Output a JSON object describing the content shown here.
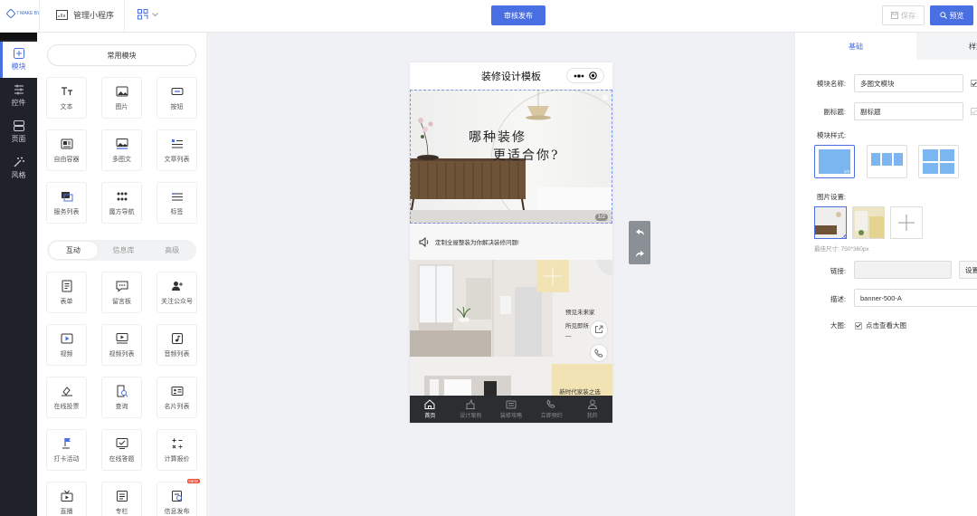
{
  "header": {
    "logo_text": "7 MAKE BY",
    "app_title": "管理小程序",
    "publish_label": "审核发布",
    "save_label": "保存",
    "preview_label": "预览"
  },
  "nav": {
    "items": [
      {
        "label": "模块"
      },
      {
        "label": "控件"
      },
      {
        "label": "页面"
      },
      {
        "label": "风格"
      }
    ]
  },
  "palette": {
    "common_label": "常用模块",
    "common": [
      {
        "label": "文本",
        "icon": "text-icon"
      },
      {
        "label": "图片",
        "icon": "image-icon"
      },
      {
        "label": "按钮",
        "icon": "button-icon"
      },
      {
        "label": "自由容器",
        "icon": "container-icon"
      },
      {
        "label": "多图文",
        "icon": "multi-image-text-icon"
      },
      {
        "label": "文章列表",
        "icon": "article-list-icon"
      },
      {
        "label": "服务列表",
        "icon": "service-list-icon"
      },
      {
        "label": "魔方导航",
        "icon": "cube-nav-icon"
      },
      {
        "label": "标签",
        "icon": "tag-icon"
      }
    ],
    "tabs": [
      "互动",
      "信息库",
      "高级"
    ],
    "interactive": [
      {
        "label": "表单",
        "icon": "form-icon"
      },
      {
        "label": "留言板",
        "icon": "message-board-icon"
      },
      {
        "label": "关注公众号",
        "icon": "follow-account-icon"
      },
      {
        "label": "视频",
        "icon": "video-icon"
      },
      {
        "label": "视频列表",
        "icon": "video-list-icon"
      },
      {
        "label": "音频列表",
        "icon": "audio-list-icon"
      },
      {
        "label": "在线投票",
        "icon": "online-vote-icon"
      },
      {
        "label": "查询",
        "icon": "query-icon"
      },
      {
        "label": "名片列表",
        "icon": "business-card-icon"
      },
      {
        "label": "打卡活动",
        "icon": "checkin-icon"
      },
      {
        "label": "在线答题",
        "icon": "online-quiz-icon"
      },
      {
        "label": "计算报价",
        "icon": "calculator-icon"
      },
      {
        "label": "直播",
        "icon": "live-icon"
      },
      {
        "label": "专栏",
        "icon": "column-icon"
      },
      {
        "label": "信息发布",
        "icon": "info-publish-icon"
      }
    ],
    "new_badge": "NEW"
  },
  "phone": {
    "title": "装修设计模板",
    "banner_line1": "哪种装修",
    "banner_line2": "更适合你?",
    "pager": "1/2",
    "notice": "定制全屋整装为你解决装修问题!",
    "card1_text1": "预见未来家",
    "card1_text2": "所见即所",
    "card1_text3": "—",
    "card2_text": "新时代家装之选",
    "tabbar": [
      {
        "label": "首页",
        "icon": "home-icon"
      },
      {
        "label": "设计案例",
        "icon": "design-case-icon"
      },
      {
        "label": "装修攻略",
        "icon": "guide-icon"
      },
      {
        "label": "立即预约",
        "icon": "booking-icon"
      },
      {
        "label": "我的",
        "icon": "profile-icon"
      }
    ]
  },
  "props": {
    "tab_basic": "基础",
    "tab_style": "样式",
    "name_label": "模块名称:",
    "name_value": "多图文模块",
    "subtitle_label": "副标题:",
    "subtitle_value": "副标题",
    "style_label": "模块样式:",
    "image_label": "图片设置:",
    "size_hint": "最佳尺寸: 750*360px",
    "link_label": "链接:",
    "link_button": "设置",
    "desc_label": "描述:",
    "desc_value": "banner-500-A",
    "bigpic_label": "大图:",
    "bigpic_option": "点击查看大图",
    "style_badge": "1/2"
  },
  "colors": {
    "accent": "#4a6fe3",
    "nav_bg": "#1f2229",
    "tabbar_bg": "#2c2d31"
  }
}
